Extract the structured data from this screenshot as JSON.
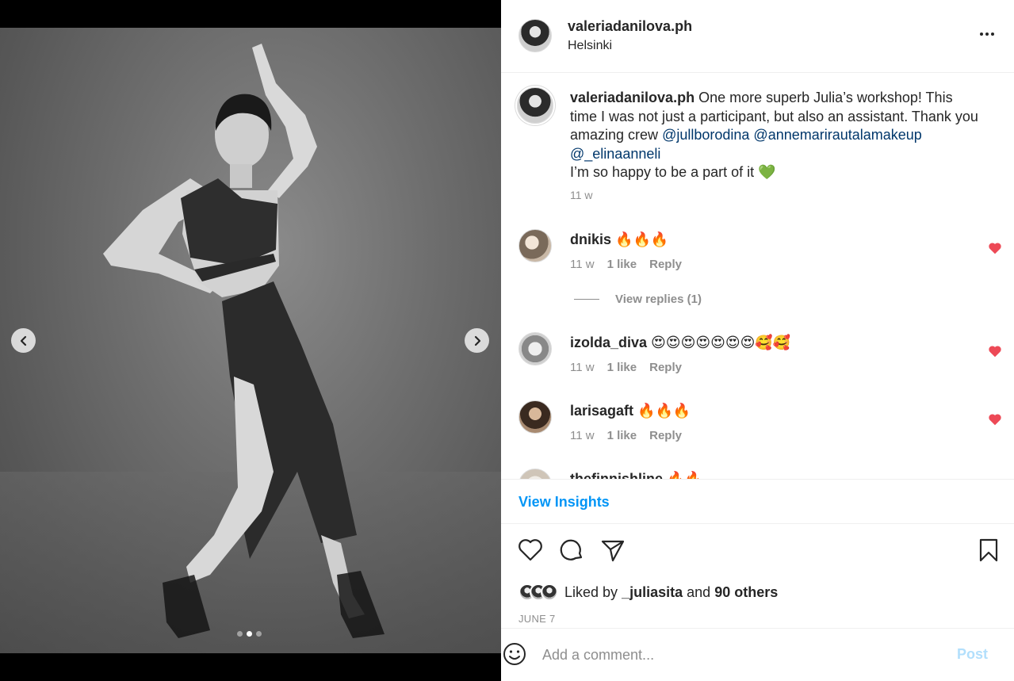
{
  "post": {
    "username": "valeriadanilova.ph",
    "location": "Helsinki",
    "more_icon": "more-horizontal-icon"
  },
  "media": {
    "prev_icon": "chevron-left-icon",
    "next_icon": "chevron-right-icon",
    "carousel_count": 3,
    "carousel_active_index": 1
  },
  "caption": {
    "username": "valeriadanilova.ph",
    "text_1": "One more superb Julia’s workshop! This time I was not just a participant, but also an assistant. Thank you amazing crew",
    "mentions": [
      "@jullborodina",
      "@annemarirautalamakeup",
      "@_elinaanneli"
    ],
    "text_2": "I’m so happy to be a part of it 💚",
    "time": "11 w"
  },
  "comments": [
    {
      "username": "dnikis",
      "text": "🔥🔥🔥",
      "time": "11 w",
      "likes": "1 like",
      "reply": "Reply",
      "liked": true
    },
    {
      "username": "izolda_diva",
      "text": "😍😍😍😍😍😍😍🥰🥰",
      "time": "11 w",
      "likes": "1 like",
      "reply": "Reply",
      "liked": true
    },
    {
      "username": "larisagaft",
      "text": "🔥🔥🔥",
      "time": "11 w",
      "likes": "1 like",
      "reply": "Reply",
      "liked": true
    },
    {
      "username": "thefinnishline",
      "text": "🔥🔥",
      "time": "",
      "likes": "",
      "reply": "",
      "liked": true
    }
  ],
  "view_replies": "View replies (1)",
  "insights_label": "View Insights",
  "actions": {
    "like_icon": "heart-outline-icon",
    "comment_icon": "comment-icon",
    "share_icon": "paper-plane-icon",
    "save_icon": "bookmark-icon"
  },
  "likes": {
    "prefix": "Liked by",
    "user": "_juliasita",
    "and": "and",
    "others": "90 others"
  },
  "date": "JUNE 7",
  "add_comment": {
    "placeholder": "Add a comment...",
    "post_label": "Post",
    "emoji_icon": "smiley-icon"
  },
  "colors": {
    "link_blue": "#0095f6",
    "mention_blue": "#00376b",
    "heart_red": "#ed4956",
    "post_disabled": "#b2dffc",
    "muted": "#8e8e8e"
  }
}
